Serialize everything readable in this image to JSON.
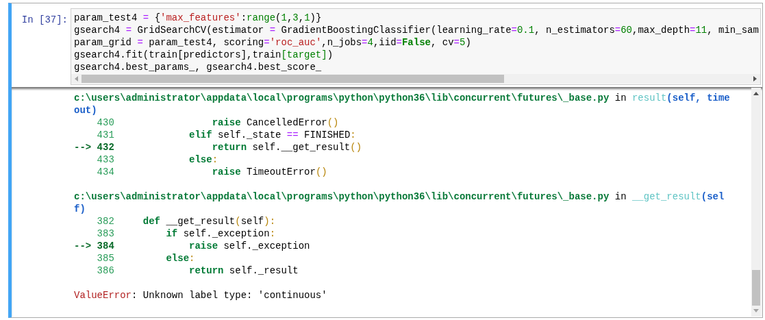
{
  "cell": {
    "prompt": "In [37]:",
    "input_lines": [
      [
        {
          "text": "param_test4 ",
          "kind": "plain"
        },
        {
          "text": "=",
          "kind": "op"
        },
        {
          "text": " {",
          "kind": "plain"
        },
        {
          "text": "'max_features'",
          "kind": "str"
        },
        {
          "text": ":",
          "kind": "plain"
        },
        {
          "text": "range",
          "kind": "builtin"
        },
        {
          "text": "(",
          "kind": "plain"
        },
        {
          "text": "1",
          "kind": "num"
        },
        {
          "text": ",",
          "kind": "plain"
        },
        {
          "text": "3",
          "kind": "num"
        },
        {
          "text": ",",
          "kind": "plain"
        },
        {
          "text": "1",
          "kind": "num"
        },
        {
          "text": ")}",
          "kind": "plain"
        }
      ],
      [
        {
          "text": "gsearch4 ",
          "kind": "plain"
        },
        {
          "text": "=",
          "kind": "op"
        },
        {
          "text": " GridSearchCV(estimator ",
          "kind": "plain"
        },
        {
          "text": "=",
          "kind": "op"
        },
        {
          "text": " GradientBoostingClassifier(learning_rate",
          "kind": "plain"
        },
        {
          "text": "=",
          "kind": "op"
        },
        {
          "text": "0.1",
          "kind": "num"
        },
        {
          "text": ", n_estimators",
          "kind": "plain"
        },
        {
          "text": "=",
          "kind": "op"
        },
        {
          "text": "60",
          "kind": "num"
        },
        {
          "text": ",max_depth",
          "kind": "plain"
        },
        {
          "text": "=",
          "kind": "op"
        },
        {
          "text": "11",
          "kind": "num"
        },
        {
          "text": ", min_sam",
          "kind": "plain"
        }
      ],
      [
        {
          "text": "param_grid ",
          "kind": "plain"
        },
        {
          "text": "=",
          "kind": "op"
        },
        {
          "text": " param_test4, scoring",
          "kind": "plain"
        },
        {
          "text": "=",
          "kind": "op"
        },
        {
          "text": "'roc_auc'",
          "kind": "str"
        },
        {
          "text": ",n_jobs",
          "kind": "plain"
        },
        {
          "text": "=",
          "kind": "op"
        },
        {
          "text": "4",
          "kind": "num"
        },
        {
          "text": ",iid",
          "kind": "plain"
        },
        {
          "text": "=",
          "kind": "op"
        },
        {
          "text": "False",
          "kind": "kw"
        },
        {
          "text": ", cv",
          "kind": "plain"
        },
        {
          "text": "=",
          "kind": "op"
        },
        {
          "text": "5",
          "kind": "num"
        },
        {
          "text": ")",
          "kind": "plain"
        }
      ],
      [
        {
          "text": "gsearch4.fit(train[predictors],train",
          "kind": "plain"
        },
        {
          "text": "[target]",
          "kind": "builtin"
        },
        {
          "text": ")",
          "kind": "plain"
        }
      ],
      [
        {
          "text": "gsearch4.best_params_, gsearch4.best_score_",
          "kind": "plain"
        }
      ]
    ],
    "traceback": [
      {
        "header": [
          [
            {
              "text": "c:\\users\\administrator\\appdata\\local\\programs\\python\\python36\\lib\\concurrent\\futures\\_base.py",
              "kind": "path"
            },
            {
              "text": " in ",
              "kind": "plain"
            },
            {
              "text": "result",
              "kind": "func"
            },
            {
              "text": "(self, time",
              "kind": "args"
            }
          ],
          [
            {
              "text": "out)",
              "kind": "args"
            }
          ]
        ],
        "source": [
          [
            {
              "text": "    430",
              "kind": "lineno"
            },
            {
              "text": "                 raise",
              "kind": "kw"
            },
            {
              "text": " CancelledError",
              "kind": "plain"
            },
            {
              "text": "()",
              "kind": "paren"
            }
          ],
          [
            {
              "text": "    431",
              "kind": "lineno"
            },
            {
              "text": "             elif",
              "kind": "kw"
            },
            {
              "text": " self._state ",
              "kind": "plain"
            },
            {
              "text": "==",
              "kind": "op"
            },
            {
              "text": " FINISHED",
              "kind": "plain"
            },
            {
              "text": ":",
              "kind": "paren"
            }
          ],
          [
            {
              "text": "--> 432",
              "kind": "arrow"
            },
            {
              "text": "                 return",
              "kind": "kw"
            },
            {
              "text": " self.__get_result",
              "kind": "plain"
            },
            {
              "text": "()",
              "kind": "paren"
            }
          ],
          [
            {
              "text": "    433",
              "kind": "lineno"
            },
            {
              "text": "             else",
              "kind": "kw"
            },
            {
              "text": ":",
              "kind": "paren"
            }
          ],
          [
            {
              "text": "    434",
              "kind": "lineno"
            },
            {
              "text": "                 raise",
              "kind": "kw"
            },
            {
              "text": " TimeoutError",
              "kind": "plain"
            },
            {
              "text": "()",
              "kind": "paren"
            }
          ]
        ]
      },
      {
        "header": [
          [
            {
              "text": "c:\\users\\administrator\\appdata\\local\\programs\\python\\python36\\lib\\concurrent\\futures\\_base.py",
              "kind": "path"
            },
            {
              "text": " in ",
              "kind": "plain"
            },
            {
              "text": "__get_result",
              "kind": "func"
            },
            {
              "text": "(sel",
              "kind": "args"
            }
          ],
          [
            {
              "text": "f)",
              "kind": "args"
            }
          ]
        ],
        "source": [
          [
            {
              "text": "    382",
              "kind": "lineno"
            },
            {
              "text": "     def",
              "kind": "kw"
            },
            {
              "text": " __get_result",
              "kind": "plain"
            },
            {
              "text": "(",
              "kind": "paren"
            },
            {
              "text": "self",
              "kind": "plain"
            },
            {
              "text": "):",
              "kind": "paren"
            }
          ],
          [
            {
              "text": "    383",
              "kind": "lineno"
            },
            {
              "text": "         if",
              "kind": "kw"
            },
            {
              "text": " self._exception",
              "kind": "plain"
            },
            {
              "text": ":",
              "kind": "paren"
            }
          ],
          [
            {
              "text": "--> 384",
              "kind": "arrow"
            },
            {
              "text": "             raise",
              "kind": "kw"
            },
            {
              "text": " self._exception",
              "kind": "plain"
            }
          ],
          [
            {
              "text": "    385",
              "kind": "lineno"
            },
            {
              "text": "         else",
              "kind": "kw"
            },
            {
              "text": ":",
              "kind": "paren"
            }
          ],
          [
            {
              "text": "    386",
              "kind": "lineno"
            },
            {
              "text": "             return",
              "kind": "kw"
            },
            {
              "text": " self._result",
              "kind": "plain"
            }
          ]
        ]
      }
    ],
    "error": [
      {
        "text": "ValueError",
        "kind": "err"
      },
      {
        "text": ": Unknown label type: 'continuous'",
        "kind": "plain"
      }
    ]
  }
}
